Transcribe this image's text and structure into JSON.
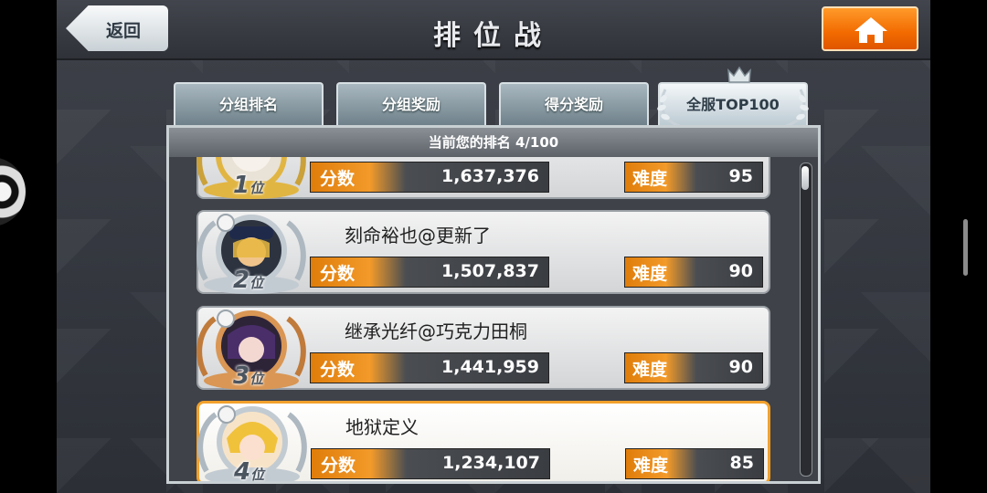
{
  "header": {
    "title": "排位战",
    "back_label": "返回"
  },
  "tabs": [
    {
      "label": "分组排名"
    },
    {
      "label": "分组奖励"
    },
    {
      "label": "得分奖励"
    },
    {
      "label": "全服TOP100"
    }
  ],
  "ranking": {
    "current_rank_text": "当前您的排名 4/100",
    "score_label": "分数",
    "difficulty_label": "难度",
    "rank_suffix": "位",
    "rows": [
      {
        "rank": "1",
        "name": "",
        "score": "1,637,376",
        "difficulty": "95",
        "medal_color": "#e1b542"
      },
      {
        "rank": "2",
        "name": "刻命裕也@更新了",
        "score": "1,507,837",
        "difficulty": "90",
        "medal_color": "#c3cbd2"
      },
      {
        "rank": "3",
        "name": "继承光纤@巧克力田桐",
        "score": "1,441,959",
        "difficulty": "90",
        "medal_color": "#d99654"
      },
      {
        "rank": "4",
        "name": "地狱定义",
        "score": "1,234,107",
        "difficulty": "85",
        "medal_color": "#c3cbd2"
      }
    ]
  },
  "colors": {
    "accent_orange": "#f07a0a",
    "highlight_border": "#f2a12c"
  },
  "icons": {
    "home": "home-icon",
    "crown": "crown-icon",
    "laurel": "laurel-wreath-icon"
  }
}
